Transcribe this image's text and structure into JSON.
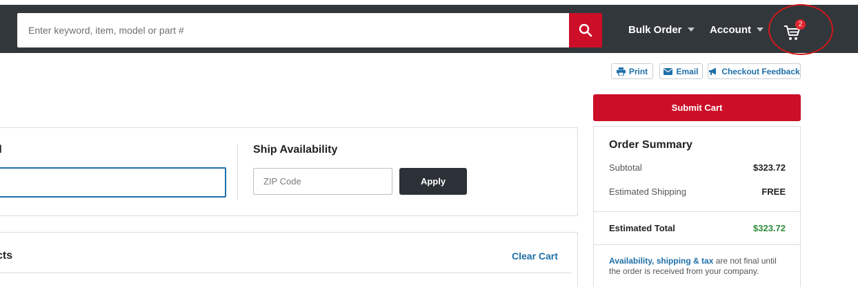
{
  "header": {
    "search": {
      "placeholder": "Enter keyword, item, model or part #",
      "value": ""
    },
    "nav": {
      "bulk_order": "Bulk Order",
      "account": "Account"
    },
    "cart_count": "2"
  },
  "utility": {
    "print": "Print",
    "email": "Email",
    "feedback": "Checkout Feedback"
  },
  "submit_label": "Submit Cart",
  "promo": {
    "title_partial": "d"
  },
  "shipping": {
    "title": "Ship Availability",
    "zip_placeholder": "ZIP Code",
    "apply_label": "Apply"
  },
  "products": {
    "title_partial": "cts",
    "clear_cart": "Clear Cart"
  },
  "summary": {
    "title": "Order Summary",
    "subtotal_label": "Subtotal",
    "subtotal_value": "$323.72",
    "shipping_label": "Estimated Shipping",
    "shipping_value": "FREE",
    "total_label": "Estimated Total",
    "total_value": "$323.72",
    "note_link": "Availability, shipping & tax",
    "note_text": " are not final until the order is received from your company."
  },
  "colors": {
    "header_bg": "#32373c",
    "brand_red": "#cc0e28",
    "link_blue": "#1e6fa8",
    "total_green": "#2e8b3a"
  }
}
